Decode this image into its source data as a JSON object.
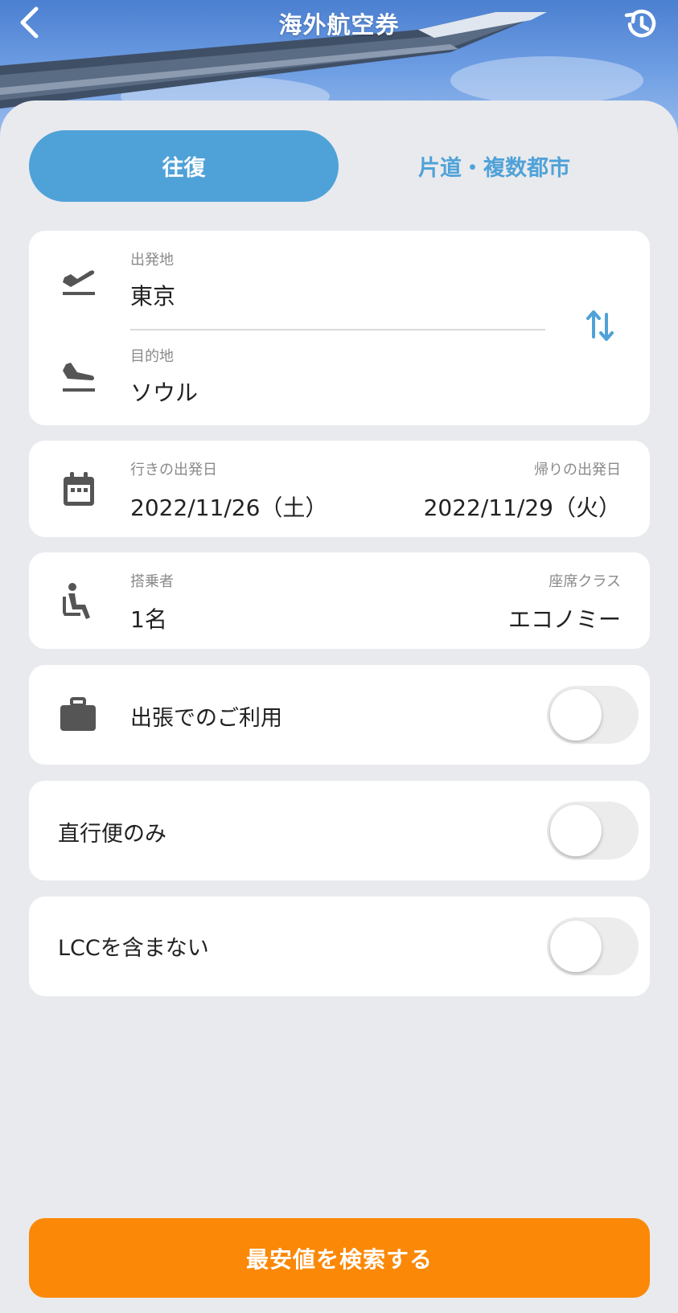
{
  "header": {
    "title": "海外航空券",
    "back_icon": "chevron-left-icon",
    "history_icon": "history-icon"
  },
  "trip_tabs": {
    "round_trip": "往復",
    "one_way_multi": "片道・複数都市",
    "active": "round_trip"
  },
  "route": {
    "origin_label": "出発地",
    "origin_value": "東京",
    "destination_label": "目的地",
    "destination_value": "ソウル",
    "swap_icon": "swap-vertical-icon"
  },
  "dates": {
    "outbound_label": "行きの出発日",
    "outbound_value": "2022/11/26（土）",
    "return_label": "帰りの出発日",
    "return_value": "2022/11/29（火）"
  },
  "passengers": {
    "passengers_label": "搭乗者",
    "passengers_value": "1名",
    "class_label": "座席クラス",
    "class_value": "エコノミー"
  },
  "options": {
    "business_label": "出張でのご利用",
    "business_on": false,
    "direct_label": "直行便のみ",
    "direct_on": false,
    "lcc_label": "LCCを含まない",
    "lcc_on": false
  },
  "search_button": "最安値を検索する",
  "colors": {
    "accent_blue": "#4fa2d8",
    "search_orange": "#fb8806",
    "background": "#e9eaee"
  }
}
